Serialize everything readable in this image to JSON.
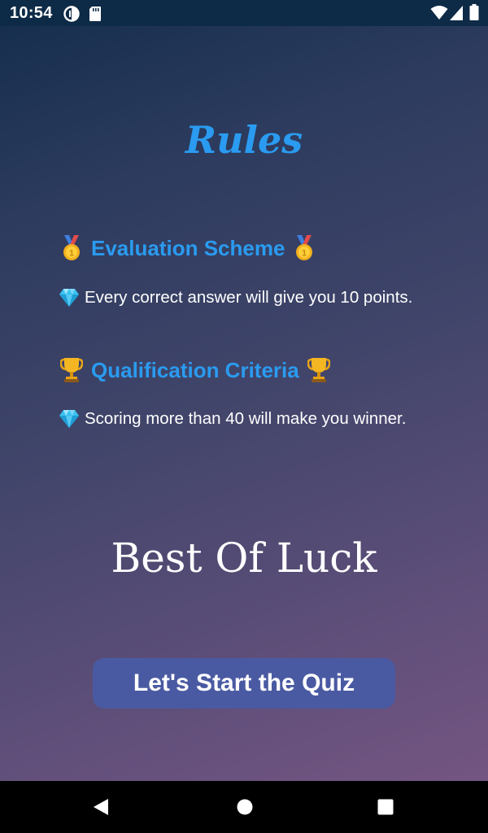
{
  "status_bar": {
    "time": "10:54",
    "icons": [
      "data-saver-icon",
      "sd-card-icon",
      "wifi-icon",
      "cellular-signal-icon",
      "battery-icon"
    ]
  },
  "rules": {
    "title": "Rules",
    "sections": [
      {
        "heading": "Evaluation Scheme",
        "heading_icon": "medal-icon",
        "line": "Every correct answer will give you 10 points.",
        "line_icon": "diamond-icon"
      },
      {
        "heading": "Qualification Criteria",
        "heading_icon": "trophy-icon",
        "line": "Scoring more than 40 will make you winner.",
        "line_icon": "diamond-icon"
      }
    ],
    "closing": "Best Of Luck",
    "start_button_label": "Let's Start the Quiz"
  },
  "nav_bar": {
    "buttons": [
      "back-icon",
      "home-icon",
      "recents-icon"
    ]
  },
  "colors": {
    "accent": "#2a9bf0",
    "button": "#4a5aa2",
    "status_bar": "#0d2a46"
  }
}
